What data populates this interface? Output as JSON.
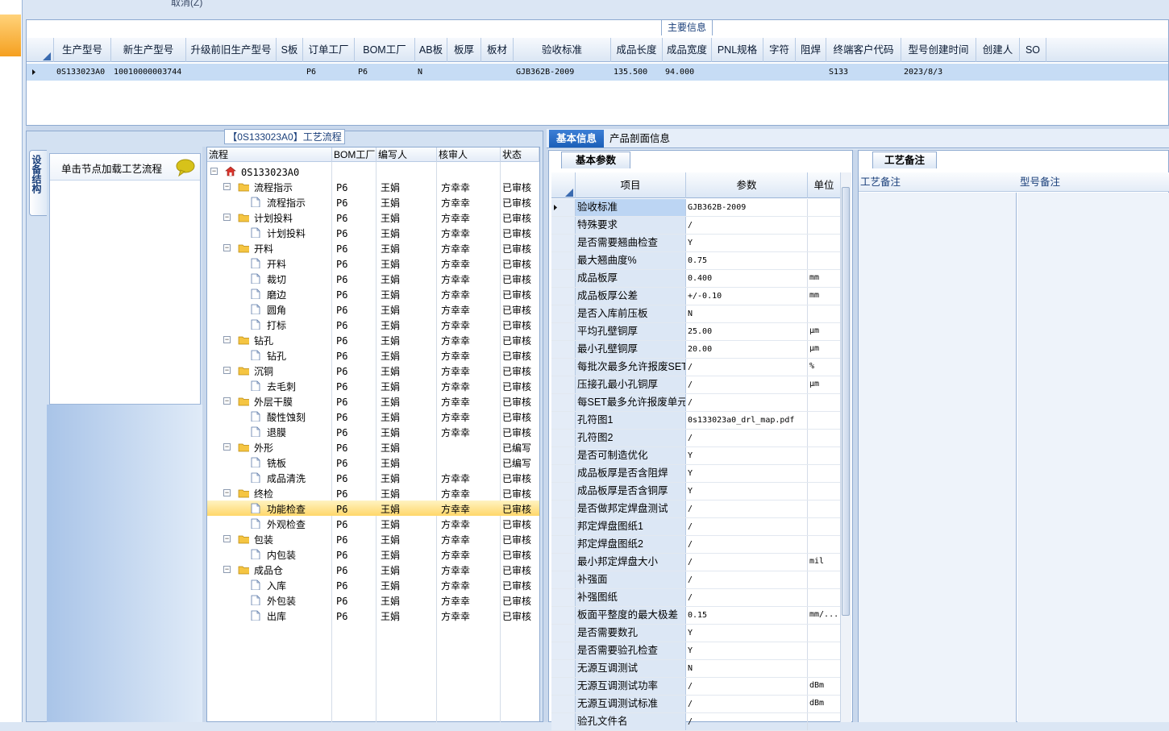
{
  "top_cut_text": "取消(Z)",
  "main_info": {
    "title": "主要信息",
    "columns": [
      "生产型号",
      "新生产型号",
      "升级前旧生产型号",
      "S板",
      "订单工厂",
      "BOM工厂",
      "AB板",
      "板厚",
      "板材",
      "验收标准",
      "成品长度",
      "成品宽度",
      "PNL规格",
      "字符",
      "阻焊",
      "终端客户代码",
      "型号创建时间",
      "创建人",
      "SO"
    ],
    "row": [
      "0S133023A0",
      "10010000003744",
      "",
      "",
      "P6",
      "P6",
      "N",
      "",
      "",
      "GJB362B-2009",
      "135.500",
      "94.000",
      "",
      "",
      "",
      "S133",
      "2023/8/3",
      "",
      ""
    ]
  },
  "process": {
    "title": "【0S133023A0】工艺流程",
    "vertical_tab": "设备结构",
    "load_hint": "单击节点加载工艺流程",
    "columns": [
      "流程",
      "BOM工厂",
      "编写人",
      "核审人",
      "状态"
    ],
    "root": "0S133023A0",
    "rows": [
      {
        "name": "流程指示",
        "level": 1,
        "bom": "P6",
        "writer": "王娟",
        "reviewer": "方幸幸",
        "status": "已审核"
      },
      {
        "name": "流程指示",
        "level": 2,
        "bom": "P6",
        "writer": "王娟",
        "reviewer": "方幸幸",
        "status": "已审核"
      },
      {
        "name": "计划投料",
        "level": 1,
        "bom": "P6",
        "writer": "王娟",
        "reviewer": "方幸幸",
        "status": "已审核"
      },
      {
        "name": "计划投料",
        "level": 2,
        "bom": "P6",
        "writer": "王娟",
        "reviewer": "方幸幸",
        "status": "已审核"
      },
      {
        "name": "开料",
        "level": 1,
        "bom": "P6",
        "writer": "王娟",
        "reviewer": "方幸幸",
        "status": "已审核"
      },
      {
        "name": "开料",
        "level": 2,
        "bom": "P6",
        "writer": "王娟",
        "reviewer": "方幸幸",
        "status": "已审核"
      },
      {
        "name": "裁切",
        "level": 2,
        "bom": "P6",
        "writer": "王娟",
        "reviewer": "方幸幸",
        "status": "已审核"
      },
      {
        "name": "磨边",
        "level": 2,
        "bom": "P6",
        "writer": "王娟",
        "reviewer": "方幸幸",
        "status": "已审核"
      },
      {
        "name": "圆角",
        "level": 2,
        "bom": "P6",
        "writer": "王娟",
        "reviewer": "方幸幸",
        "status": "已审核"
      },
      {
        "name": "打标",
        "level": 2,
        "bom": "P6",
        "writer": "王娟",
        "reviewer": "方幸幸",
        "status": "已审核"
      },
      {
        "name": "钻孔",
        "level": 1,
        "bom": "P6",
        "writer": "王娟",
        "reviewer": "方幸幸",
        "status": "已审核"
      },
      {
        "name": "钻孔",
        "level": 2,
        "bom": "P6",
        "writer": "王娟",
        "reviewer": "方幸幸",
        "status": "已审核"
      },
      {
        "name": "沉铜",
        "level": 1,
        "bom": "P6",
        "writer": "王娟",
        "reviewer": "方幸幸",
        "status": "已审核"
      },
      {
        "name": "去毛刺",
        "level": 2,
        "bom": "P6",
        "writer": "王娟",
        "reviewer": "方幸幸",
        "status": "已审核"
      },
      {
        "name": "外层干膜",
        "level": 1,
        "bom": "P6",
        "writer": "王娟",
        "reviewer": "方幸幸",
        "status": "已审核"
      },
      {
        "name": "酸性蚀刻",
        "level": 2,
        "bom": "P6",
        "writer": "王娟",
        "reviewer": "方幸幸",
        "status": "已审核"
      },
      {
        "name": "退膜",
        "level": 2,
        "bom": "P6",
        "writer": "王娟",
        "reviewer": "方幸幸",
        "status": "已审核"
      },
      {
        "name": "外形",
        "level": 1,
        "bom": "P6",
        "writer": "王娟",
        "reviewer": "",
        "status": "已编写"
      },
      {
        "name": "铣板",
        "level": 2,
        "bom": "P6",
        "writer": "王娟",
        "reviewer": "",
        "status": "已编写"
      },
      {
        "name": "成品清洗",
        "level": 2,
        "bom": "P6",
        "writer": "王娟",
        "reviewer": "方幸幸",
        "status": "已审核"
      },
      {
        "name": "终检",
        "level": 1,
        "bom": "P6",
        "writer": "王娟",
        "reviewer": "方幸幸",
        "status": "已审核"
      },
      {
        "name": "功能检查",
        "level": 2,
        "bom": "P6",
        "writer": "王娟",
        "reviewer": "方幸幸",
        "status": "已审核",
        "selected": true
      },
      {
        "name": "外观检查",
        "level": 2,
        "bom": "P6",
        "writer": "王娟",
        "reviewer": "方幸幸",
        "status": "已审核"
      },
      {
        "name": "包装",
        "level": 1,
        "bom": "P6",
        "writer": "王娟",
        "reviewer": "方幸幸",
        "status": "已审核"
      },
      {
        "name": "内包装",
        "level": 2,
        "bom": "P6",
        "writer": "王娟",
        "reviewer": "方幸幸",
        "status": "已审核"
      },
      {
        "name": "成品仓",
        "level": 1,
        "bom": "P6",
        "writer": "王娟",
        "reviewer": "方幸幸",
        "status": "已审核"
      },
      {
        "name": "入库",
        "level": 2,
        "bom": "P6",
        "writer": "王娟",
        "reviewer": "方幸幸",
        "status": "已审核"
      },
      {
        "name": "外包装",
        "level": 2,
        "bom": "P6",
        "writer": "王娟",
        "reviewer": "方幸幸",
        "status": "已审核"
      },
      {
        "name": "出库",
        "level": 2,
        "bom": "P6",
        "writer": "王娟",
        "reviewer": "方幸幸",
        "status": "已审核"
      }
    ]
  },
  "right_tabs": {
    "basic": "基本信息",
    "section": "产品剖面信息"
  },
  "basic_params": {
    "title": "基本参数",
    "columns": [
      "项目",
      "参数",
      "单位"
    ],
    "rows": [
      {
        "name": "验收标准",
        "value": "GJB362B-2009",
        "unit": "",
        "selected": true
      },
      {
        "name": "特殊要求",
        "value": "/",
        "unit": ""
      },
      {
        "name": "是否需要翘曲检查",
        "value": "Y",
        "unit": ""
      },
      {
        "name": "最大翘曲度%",
        "value": "0.75",
        "unit": ""
      },
      {
        "name": "成品板厚",
        "value": "0.400",
        "unit": "mm"
      },
      {
        "name": "成品板厚公差",
        "value": "+/-0.10",
        "unit": "mm"
      },
      {
        "name": "是否入库前压板",
        "value": "N",
        "unit": ""
      },
      {
        "name": "平均孔壁铜厚",
        "value": "25.00",
        "unit": "μm"
      },
      {
        "name": "最小孔壁铜厚",
        "value": "20.00",
        "unit": "μm"
      },
      {
        "name": "每批次最多允许报废SET",
        "value": "/",
        "unit": "%"
      },
      {
        "name": "压接孔最小孔铜厚",
        "value": "/",
        "unit": "μm"
      },
      {
        "name": "每SET最多允许报废单元",
        "value": "/",
        "unit": ""
      },
      {
        "name": "孔符图1",
        "value": "0s133023a0_drl_map.pdf",
        "unit": ""
      },
      {
        "name": "孔符图2",
        "value": "/",
        "unit": ""
      },
      {
        "name": "是否可制造优化",
        "value": "Y",
        "unit": ""
      },
      {
        "name": "成品板厚是否含阻焊",
        "value": "Y",
        "unit": ""
      },
      {
        "name": "成品板厚是否含铜厚",
        "value": "Y",
        "unit": ""
      },
      {
        "name": "是否做邦定焊盘测试",
        "value": "/",
        "unit": ""
      },
      {
        "name": "邦定焊盘图纸1",
        "value": "/",
        "unit": ""
      },
      {
        "name": "邦定焊盘图纸2",
        "value": "/",
        "unit": ""
      },
      {
        "name": "最小邦定焊盘大小",
        "value": "/",
        "unit": "mil"
      },
      {
        "name": "补强面",
        "value": "/",
        "unit": ""
      },
      {
        "name": "补强图纸",
        "value": "/",
        "unit": ""
      },
      {
        "name": "板面平整度的最大极差",
        "value": "0.15",
        "unit": "mm/..."
      },
      {
        "name": "是否需要数孔",
        "value": "Y",
        "unit": ""
      },
      {
        "name": "是否需要验孔检查",
        "value": "Y",
        "unit": ""
      },
      {
        "name": "无源互调测试",
        "value": "N",
        "unit": ""
      },
      {
        "name": "无源互调测试功率",
        "value": "/",
        "unit": "dBm"
      },
      {
        "name": "无源互调测试标准",
        "value": "/",
        "unit": "dBm"
      },
      {
        "name": "验孔文件名",
        "value": "/",
        "unit": ""
      }
    ]
  },
  "remarks": {
    "title": "工艺备注",
    "process_remark_label": "工艺备注",
    "model_remark_label": "型号备注"
  }
}
